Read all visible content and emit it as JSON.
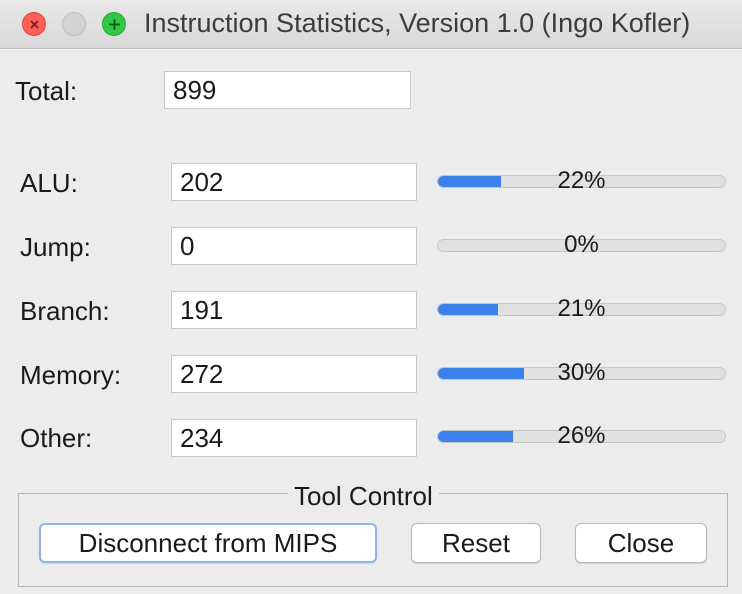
{
  "window": {
    "title": "Instruction Statistics, Version 1.0 (Ingo Kofler)"
  },
  "total": {
    "label": "Total:",
    "value": "899"
  },
  "stats": [
    {
      "label": "ALU:",
      "value": "202",
      "percent_text": "22%",
      "fraction": 0.22
    },
    {
      "label": "Jump:",
      "value": "0",
      "percent_text": "0%",
      "fraction": 0.0
    },
    {
      "label": "Branch:",
      "value": "191",
      "percent_text": "21%",
      "fraction": 0.21
    },
    {
      "label": "Memory:",
      "value": "272",
      "percent_text": "30%",
      "fraction": 0.3
    },
    {
      "label": "Other:",
      "value": "234",
      "percent_text": "26%",
      "fraction": 0.26
    }
  ],
  "tool_control": {
    "legend": "Tool Control",
    "disconnect_label": "Disconnect from MIPS",
    "reset_label": "Reset",
    "close_label": "Close"
  },
  "colors": {
    "progress_fill": "#3a81ee",
    "close_light": "#fc5f57",
    "zoom_light": "#33c748"
  }
}
